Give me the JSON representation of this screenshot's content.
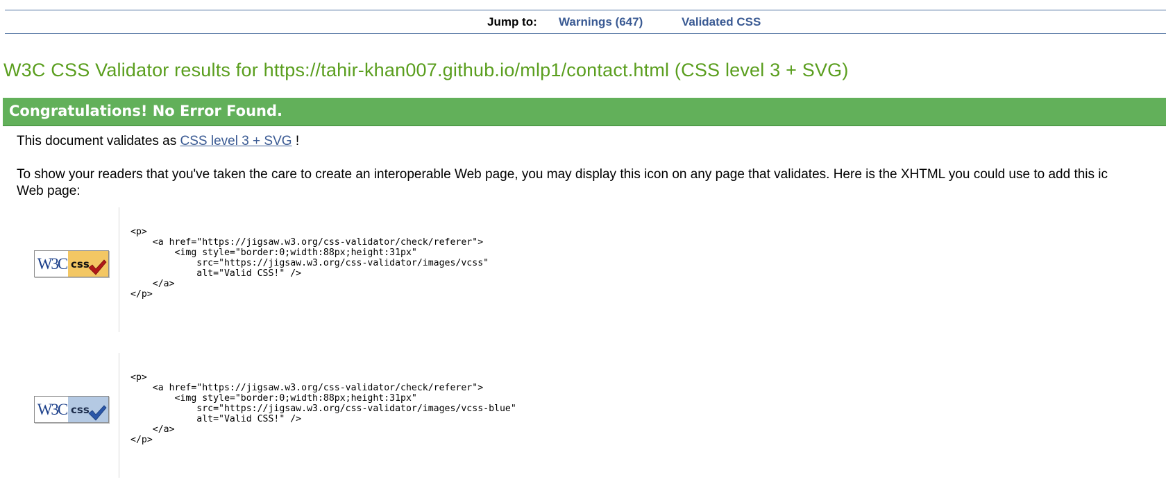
{
  "nav": {
    "jump_to_label": "Jump to:",
    "warnings_link": "Warnings (647)",
    "validated_css_link": "Validated CSS"
  },
  "title": "W3C CSS Validator results for https://tahir-khan007.github.io/mlp1/contact.html (CSS level 3 + SVG)",
  "banner": "Congratulations! No Error Found.",
  "validates": {
    "prefix": "This document validates as ",
    "link": "CSS level 3 + SVG",
    "suffix": " !"
  },
  "show_paragraph": {
    "line1": "To show your readers that you've taken the care to create an interoperable Web page, you may display this icon on any page that validates. Here is the XHTML you could use to add this ic",
    "line2": "Web page:"
  },
  "badges": [
    {
      "icon": "w3c-css-valid-gold-icon",
      "w3c_text": "W3C",
      "css_text": "css",
      "color": "#f3c764",
      "check_color": "#b01818",
      "code": "<p>\n    <a href=\"https://jigsaw.w3.org/css-validator/check/referer\">\n        <img style=\"border:0;width:88px;height:31px\"\n            src=\"https://jigsaw.w3.org/css-validator/images/vcss\"\n            alt=\"Valid CSS!\" />\n    </a>\n</p>"
    },
    {
      "icon": "w3c-css-valid-blue-icon",
      "w3c_text": "W3C",
      "css_text": "css",
      "color": "#b4c9e3",
      "check_color": "#2a56a8",
      "code": "<p>\n    <a href=\"https://jigsaw.w3.org/css-validator/check/referer\">\n        <img style=\"border:0;width:88px;height:31px\"\n            src=\"https://jigsaw.w3.org/css-validator/images/vcss-blue\"\n            alt=\"Valid CSS!\" />\n    </a>\n</p>"
    }
  ],
  "colors": {
    "title": "#5a9e1e",
    "banner": "#62b05a",
    "link": "#3a5a93"
  }
}
